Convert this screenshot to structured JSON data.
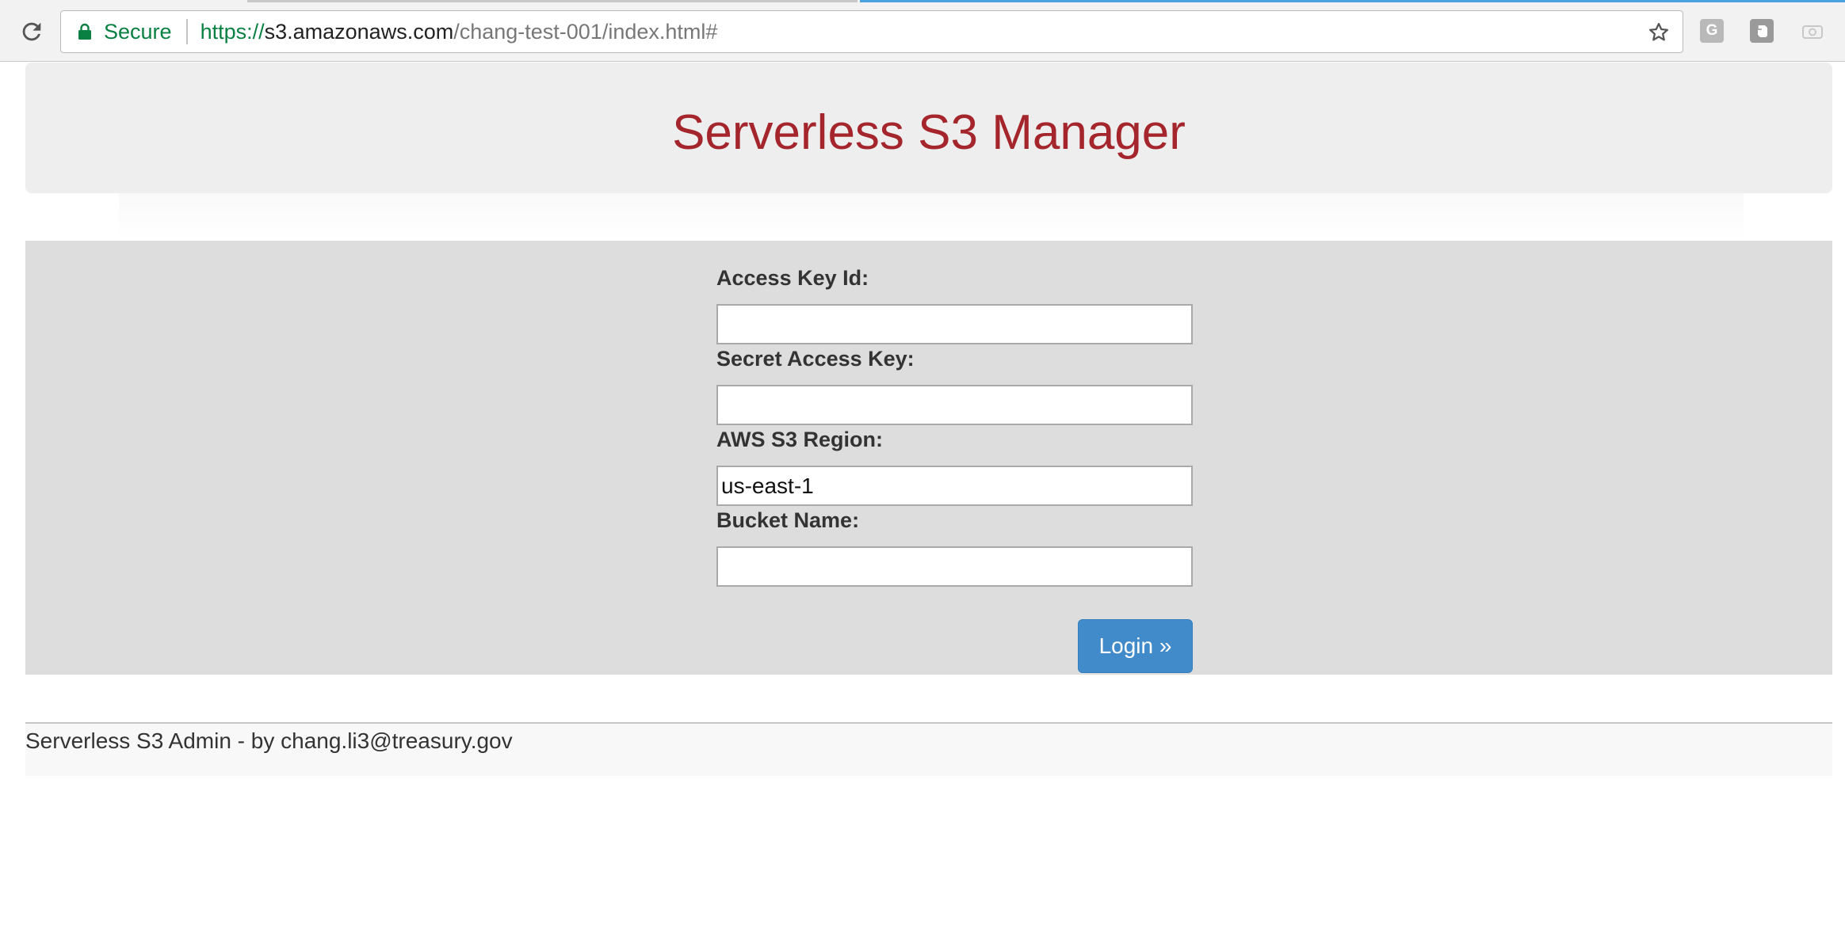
{
  "browser": {
    "secure_label": "Secure",
    "url": {
      "scheme": "https://",
      "host": "s3.amazonaws.com",
      "path": "/chang-test-001/index.html#"
    },
    "extensions": [
      {
        "name": "g-extension-icon",
        "glyph": "G"
      },
      {
        "name": "evernote-extension-icon",
        "glyph": ""
      },
      {
        "name": "camera-extension-icon",
        "glyph": ""
      }
    ]
  },
  "header": {
    "title": "Serverless S3 Manager"
  },
  "login_form": {
    "access_key": {
      "label": "Access Key Id:",
      "value": ""
    },
    "secret_key": {
      "label": "Secret Access Key:",
      "value": ""
    },
    "region": {
      "label": "AWS S3 Region:",
      "value": "us-east-1"
    },
    "bucket": {
      "label": "Bucket Name:",
      "value": ""
    },
    "login_button": "Login »"
  },
  "footer": {
    "text": "Serverless S3 Admin - by chang.li3@treasury.gov"
  },
  "colors": {
    "title": "#a4262c",
    "button": "#428bca",
    "secure": "#0b8043",
    "panel": "#dddddd",
    "jumbotron": "#eeeeee"
  }
}
